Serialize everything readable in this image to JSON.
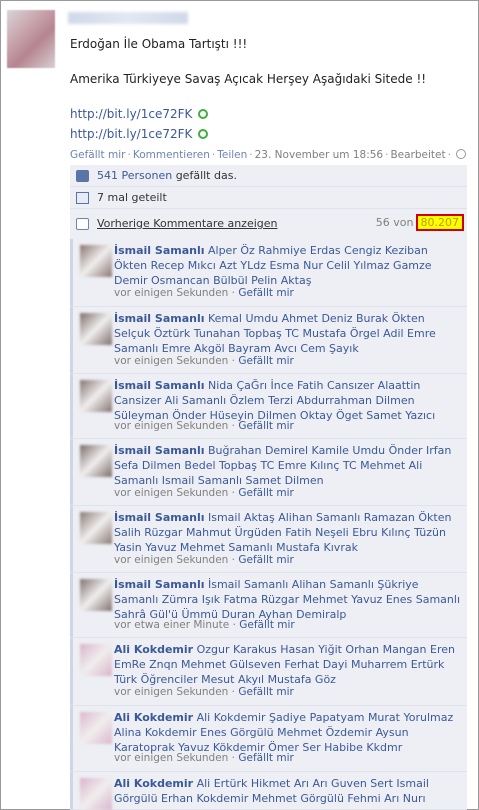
{
  "post": {
    "title": "Erdoğan İle Obama Tartıştı !!!",
    "body": "Amerika Türkiyeye Savaş Açıcak Herşey Aşağıdaki Sitede !!",
    "links": [
      "http://bit.ly/1ce72FK",
      "http://bit.ly/1ce72FK"
    ],
    "actions": {
      "like": "Gefällt mir",
      "comment": "Kommentieren",
      "share": "Teilen",
      "timestamp": "23. November um 18:56",
      "edited": "Bearbeitet"
    }
  },
  "ufi": {
    "likes_count": "541 Personen",
    "likes_suffix": "gefällt das.",
    "shares": "7 mal geteilt",
    "prev_comments": "Vorherige Kommentare anzeigen",
    "count_prefix": "56 von",
    "count_total": "80.207"
  },
  "comments": [
    {
      "author": "İsmail Samanlı",
      "text": "Alper Öz Rahmiye Erdas Cengiz Keziban Ökten Recep Mıkcı Azt YLdz Esma Nur Celil Yılmaz Gamze Demir Osmancan Bülbül Pelin Aktaş",
      "time": "vor einigen Sekunden",
      "like": "Gefällt mir",
      "avatar": "#8a7570"
    },
    {
      "author": "İsmail Samanlı",
      "text": "Kemal Umdu Ahmet Deniz Burak Ökten Selçuk Öztürk Tunahan Topbaş TC Mustafa Örgel Adil Emre Samanlı Emre Akgöl Bayram Avcı Cem Şayık",
      "time": "vor einigen Sekunden",
      "like": "Gefällt mir",
      "avatar": "#7e6f6a"
    },
    {
      "author": "İsmail Samanlı",
      "text": "Nida ÇaĞrı İnce Fatih Cansızer Alaattin Cansizer Ali Samanlı Özlem Terzi Abdurrahman Dilmen Süleyman Önder Hüseyin Dilmen Oktay Öget Samet Yazıcı",
      "time": "vor einigen Sekunden",
      "like": "Gefällt mir",
      "avatar": "#857570"
    },
    {
      "author": "İsmail Samanlı",
      "text": "Buğrahan Demirel Kamile Umdu Önder Irfan Sefa Dilmen Bedel Topbaş TC Emre Kılınç TC Mehmet Ali Samanlı Ismail Samanlı Samet Dilmen",
      "time": "vor einigen Sekunden",
      "like": "Gefällt mir",
      "avatar": "#7a6d68"
    },
    {
      "author": "İsmail Samanlı",
      "text": "Ismail Aktaş Alihan Samanlı Ramazan Ökten Salih Rüzgar Mahmut Ürgüden Fatih Neşeli Ebru Kılınç Tüzün Yasin Yavuz Mehmet Samanlı Mustafa Kıvrak",
      "time": "vor einigen Sekunden",
      "like": "Gefällt mir",
      "avatar": "#8a7a74"
    },
    {
      "author": "İsmail Samanlı",
      "text": "İsmail Samanlı Alihan Samanlı Şükriye Samanlı Zümra Işık Fatma Rüzgar Mehmet Yavuz Enes Samanlı Sahrâ Gül'ü Ümmü Duran Ayhan Demiralp",
      "time": "vor etwa einer Minute",
      "like": "Gefällt mir",
      "avatar": "#807270"
    },
    {
      "author": "Ali Kokdemir",
      "text": "Ozgur Karakus Hasan Yiğit Orhan Mangan Eren EmRe Znqn Mehmet Gülseven Ferhat Dayi Muharrem Ertürk Türk Öğrenciler Mesut Akyıl Mustafa Göz",
      "time": "vor einigen Sekunden",
      "like": "Gefällt mir",
      "avatar": "#d9b4c9"
    },
    {
      "author": "Ali Kokdemir",
      "text": "Ali Kokdemir Şadiye Papatyam Murat Yorulmaz Alina Kokdemir Enes Görgülü Mehmet Özdemir Aysun Karatoprak Yavuz Kökdemir Ömer Ser Habibe Kkdmr",
      "time": "vor einigen Sekunden",
      "like": "Gefällt mir",
      "avatar": "#dcb7cd"
    },
    {
      "author": "Ali Kokdemir",
      "text": "Ali Ertürk Hikmet Arı Arı Guven Sert Ismail Görgülü Erhan Kokdemir Mehmet Görgülü Fehmi Arı Nurı",
      "time": "",
      "like": "",
      "avatar": "#dab5cb"
    }
  ]
}
